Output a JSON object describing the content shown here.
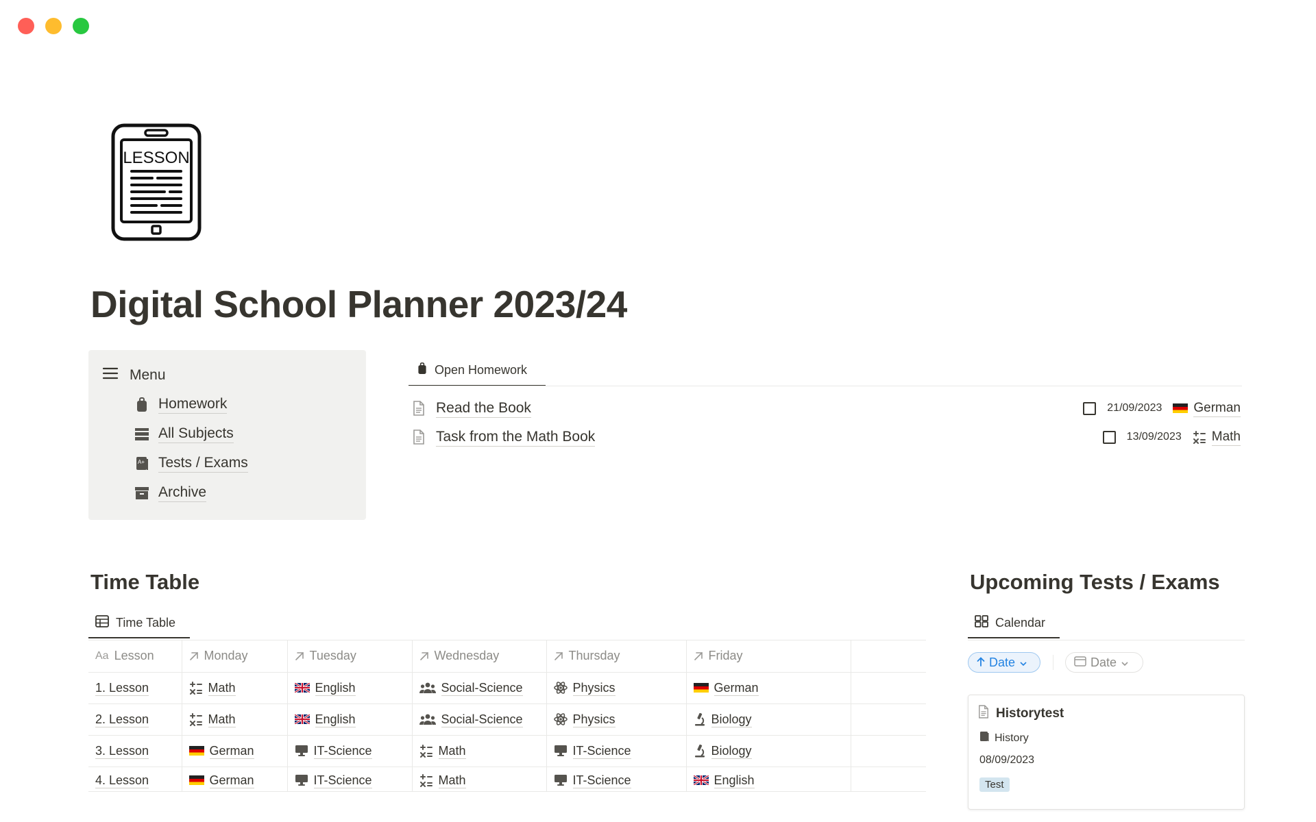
{
  "window": {
    "controls": [
      "close",
      "minimize",
      "maximize"
    ]
  },
  "page": {
    "title": "Digital School Planner 2023/24",
    "icon": "lesson-tablet-icon",
    "icon_text": "LESSON"
  },
  "menu": {
    "label": "Menu",
    "items": [
      {
        "label": "Homework",
        "icon": "backpack-icon"
      },
      {
        "label": "All Subjects",
        "icon": "stack-icon"
      },
      {
        "label": "Tests / Exams",
        "icon": "grade-book-icon"
      },
      {
        "label": "Archive",
        "icon": "archive-icon"
      }
    ]
  },
  "homework": {
    "tab_label": "Open Homework",
    "rows": [
      {
        "title": "Read the Book",
        "date": "21/09/2023",
        "subject": "German",
        "subject_icon": "german-flag-icon"
      },
      {
        "title": "Task from the Math Book",
        "date": "13/09/2023",
        "subject": "Math",
        "subject_icon": "math-icon"
      }
    ]
  },
  "timetable": {
    "section_title": "Time Table",
    "tab_label": "Time Table",
    "title_prefix": "Aa",
    "columns": [
      "Lesson",
      "Monday",
      "Tuesday",
      "Wednesday",
      "Thursday",
      "Friday"
    ],
    "rows": [
      {
        "lesson": "1. Lesson",
        "cells": [
          {
            "t": "Math",
            "i": "math"
          },
          {
            "t": "English",
            "i": "uk"
          },
          {
            "t": "Social-Science",
            "i": "people"
          },
          {
            "t": "Physics",
            "i": "atom"
          },
          {
            "t": "German",
            "i": "de"
          }
        ]
      },
      {
        "lesson": "2. Lesson",
        "cells": [
          {
            "t": "Math",
            "i": "math"
          },
          {
            "t": "English",
            "i": "uk"
          },
          {
            "t": "Social-Science",
            "i": "people"
          },
          {
            "t": "Physics",
            "i": "atom"
          },
          {
            "t": "Biology",
            "i": "microscope"
          }
        ]
      },
      {
        "lesson": "3. Lesson",
        "cells": [
          {
            "t": "German",
            "i": "de"
          },
          {
            "t": "IT-Science",
            "i": "computer"
          },
          {
            "t": "Math",
            "i": "math"
          },
          {
            "t": "IT-Science",
            "i": "computer"
          },
          {
            "t": "Biology",
            "i": "microscope"
          }
        ]
      },
      {
        "lesson": "4. Lesson",
        "cells": [
          {
            "t": "German",
            "i": "de"
          },
          {
            "t": "IT-Science",
            "i": "computer"
          },
          {
            "t": "Math",
            "i": "math"
          },
          {
            "t": "IT-Science",
            "i": "computer"
          },
          {
            "t": "English",
            "i": "uk"
          }
        ]
      }
    ]
  },
  "upcoming": {
    "section_title": "Upcoming Tests / Exams",
    "tab_label": "Calendar",
    "sort_label": "Date",
    "filter_label": "Date",
    "card": {
      "title": "Historytest",
      "subject": "History",
      "date": "08/09/2023",
      "tag": "Test"
    }
  },
  "colors": {
    "text": "#37352f",
    "muted": "#8c8b87",
    "callout_bg": "#f1f1ef",
    "accent_blue": "#2383e2",
    "tag_blue": "#d3e5ef",
    "traffic_red": "#ff5f57",
    "traffic_yellow": "#febc2e",
    "traffic_green": "#28c840"
  }
}
